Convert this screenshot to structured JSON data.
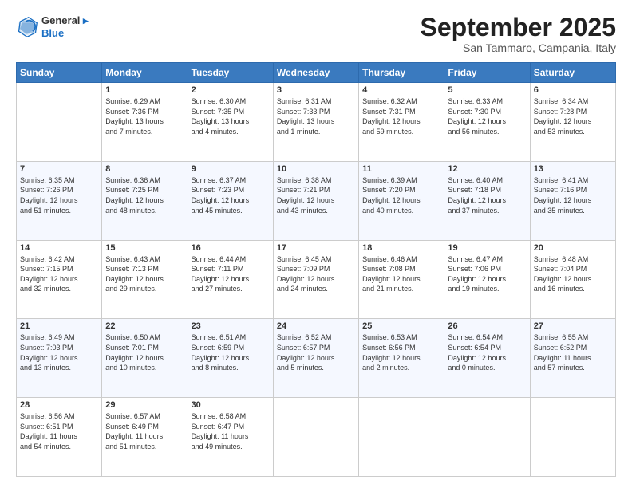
{
  "header": {
    "logo_line1": "General",
    "logo_line2": "Blue",
    "month_title": "September 2025",
    "location": "San Tammaro, Campania, Italy"
  },
  "days_of_week": [
    "Sunday",
    "Monday",
    "Tuesday",
    "Wednesday",
    "Thursday",
    "Friday",
    "Saturday"
  ],
  "weeks": [
    [
      {
        "day": "",
        "info": ""
      },
      {
        "day": "1",
        "info": "Sunrise: 6:29 AM\nSunset: 7:36 PM\nDaylight: 13 hours\nand 7 minutes."
      },
      {
        "day": "2",
        "info": "Sunrise: 6:30 AM\nSunset: 7:35 PM\nDaylight: 13 hours\nand 4 minutes."
      },
      {
        "day": "3",
        "info": "Sunrise: 6:31 AM\nSunset: 7:33 PM\nDaylight: 13 hours\nand 1 minute."
      },
      {
        "day": "4",
        "info": "Sunrise: 6:32 AM\nSunset: 7:31 PM\nDaylight: 12 hours\nand 59 minutes."
      },
      {
        "day": "5",
        "info": "Sunrise: 6:33 AM\nSunset: 7:30 PM\nDaylight: 12 hours\nand 56 minutes."
      },
      {
        "day": "6",
        "info": "Sunrise: 6:34 AM\nSunset: 7:28 PM\nDaylight: 12 hours\nand 53 minutes."
      }
    ],
    [
      {
        "day": "7",
        "info": "Sunrise: 6:35 AM\nSunset: 7:26 PM\nDaylight: 12 hours\nand 51 minutes."
      },
      {
        "day": "8",
        "info": "Sunrise: 6:36 AM\nSunset: 7:25 PM\nDaylight: 12 hours\nand 48 minutes."
      },
      {
        "day": "9",
        "info": "Sunrise: 6:37 AM\nSunset: 7:23 PM\nDaylight: 12 hours\nand 45 minutes."
      },
      {
        "day": "10",
        "info": "Sunrise: 6:38 AM\nSunset: 7:21 PM\nDaylight: 12 hours\nand 43 minutes."
      },
      {
        "day": "11",
        "info": "Sunrise: 6:39 AM\nSunset: 7:20 PM\nDaylight: 12 hours\nand 40 minutes."
      },
      {
        "day": "12",
        "info": "Sunrise: 6:40 AM\nSunset: 7:18 PM\nDaylight: 12 hours\nand 37 minutes."
      },
      {
        "day": "13",
        "info": "Sunrise: 6:41 AM\nSunset: 7:16 PM\nDaylight: 12 hours\nand 35 minutes."
      }
    ],
    [
      {
        "day": "14",
        "info": "Sunrise: 6:42 AM\nSunset: 7:15 PM\nDaylight: 12 hours\nand 32 minutes."
      },
      {
        "day": "15",
        "info": "Sunrise: 6:43 AM\nSunset: 7:13 PM\nDaylight: 12 hours\nand 29 minutes."
      },
      {
        "day": "16",
        "info": "Sunrise: 6:44 AM\nSunset: 7:11 PM\nDaylight: 12 hours\nand 27 minutes."
      },
      {
        "day": "17",
        "info": "Sunrise: 6:45 AM\nSunset: 7:09 PM\nDaylight: 12 hours\nand 24 minutes."
      },
      {
        "day": "18",
        "info": "Sunrise: 6:46 AM\nSunset: 7:08 PM\nDaylight: 12 hours\nand 21 minutes."
      },
      {
        "day": "19",
        "info": "Sunrise: 6:47 AM\nSunset: 7:06 PM\nDaylight: 12 hours\nand 19 minutes."
      },
      {
        "day": "20",
        "info": "Sunrise: 6:48 AM\nSunset: 7:04 PM\nDaylight: 12 hours\nand 16 minutes."
      }
    ],
    [
      {
        "day": "21",
        "info": "Sunrise: 6:49 AM\nSunset: 7:03 PM\nDaylight: 12 hours\nand 13 minutes."
      },
      {
        "day": "22",
        "info": "Sunrise: 6:50 AM\nSunset: 7:01 PM\nDaylight: 12 hours\nand 10 minutes."
      },
      {
        "day": "23",
        "info": "Sunrise: 6:51 AM\nSunset: 6:59 PM\nDaylight: 12 hours\nand 8 minutes."
      },
      {
        "day": "24",
        "info": "Sunrise: 6:52 AM\nSunset: 6:57 PM\nDaylight: 12 hours\nand 5 minutes."
      },
      {
        "day": "25",
        "info": "Sunrise: 6:53 AM\nSunset: 6:56 PM\nDaylight: 12 hours\nand 2 minutes."
      },
      {
        "day": "26",
        "info": "Sunrise: 6:54 AM\nSunset: 6:54 PM\nDaylight: 12 hours\nand 0 minutes."
      },
      {
        "day": "27",
        "info": "Sunrise: 6:55 AM\nSunset: 6:52 PM\nDaylight: 11 hours\nand 57 minutes."
      }
    ],
    [
      {
        "day": "28",
        "info": "Sunrise: 6:56 AM\nSunset: 6:51 PM\nDaylight: 11 hours\nand 54 minutes."
      },
      {
        "day": "29",
        "info": "Sunrise: 6:57 AM\nSunset: 6:49 PM\nDaylight: 11 hours\nand 51 minutes."
      },
      {
        "day": "30",
        "info": "Sunrise: 6:58 AM\nSunset: 6:47 PM\nDaylight: 11 hours\nand 49 minutes."
      },
      {
        "day": "",
        "info": ""
      },
      {
        "day": "",
        "info": ""
      },
      {
        "day": "",
        "info": ""
      },
      {
        "day": "",
        "info": ""
      }
    ]
  ]
}
